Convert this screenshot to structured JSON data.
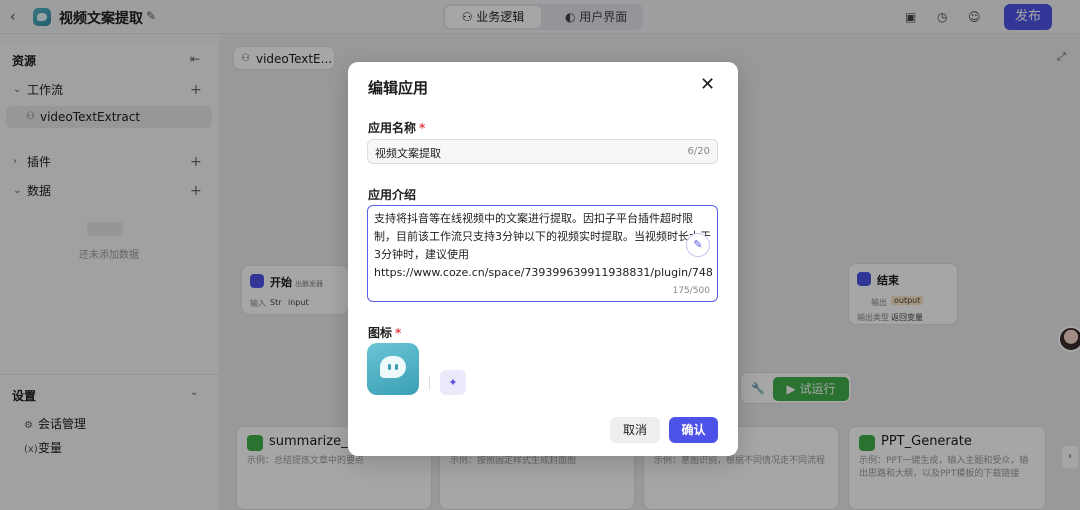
{
  "header": {
    "back_icon": "chevron-left-icon",
    "app_title": "视频文案提取",
    "tabs": [
      {
        "label": "业务逻辑",
        "icon": "flow-icon",
        "active": true
      },
      {
        "label": "用户界面",
        "icon": "palette-icon",
        "active": false
      }
    ],
    "publish_label": "发布",
    "accent_color": "#4d53e8"
  },
  "sidebar": {
    "title": "资源",
    "sections": [
      {
        "label": "工作流",
        "expanded": true
      },
      {
        "label": "插件",
        "expanded": false
      },
      {
        "label": "数据",
        "expanded": true
      }
    ],
    "workflow_item": "videoTextExtract",
    "empty_data": "还未添加数据",
    "settings": {
      "title": "设置",
      "items": [
        {
          "label": "会话管理",
          "icon": "chat-settings-icon"
        },
        {
          "label": "变量",
          "icon": "variable-icon"
        }
      ]
    }
  },
  "canvas": {
    "tab_label": "videoTextE...",
    "start_node": {
      "title": "开始",
      "subtitle": "出触发器",
      "input_key": "输入",
      "input_value": "input",
      "input_type": "Str"
    },
    "end_node": {
      "title": "结束",
      "output_key": "输出",
      "output_value": "output",
      "output_type_key": "输出类型",
      "output_type_value": "返回变量"
    },
    "run_label": "试运行",
    "cards": [
      {
        "title": "summarize_ar",
        "desc": "示例：总结提炼文章中的要点"
      },
      {
        "title": "",
        "desc": "示例：按照固定样式生成封面图"
      },
      {
        "title": "",
        "desc": "示例：意图识别，根据不同情况走不同流程"
      },
      {
        "title": "PPT_Generate",
        "desc": "示例：PPT一键生成，输入主题和受众，输出思路和大纲，以及PPT模板的下载链接"
      }
    ]
  },
  "modal": {
    "title": "编辑应用",
    "name_label": "应用名称",
    "name_value": "视频文案提取",
    "name_count": "6/20",
    "desc_label": "应用介绍",
    "desc_value": "支持将抖音等在线视频中的文案进行提取。因扣子平台插件超时限制，目前该工作流只支持3分钟以下的视频实时提取。当视频时长大于3分钟时，建议使用https://www.coze.cn/space/739399639911938831/plugin/748",
    "desc_count": "175/500",
    "icon_label": "图标",
    "required_mark": "*",
    "cancel_label": "取消",
    "confirm_label": "确认"
  }
}
